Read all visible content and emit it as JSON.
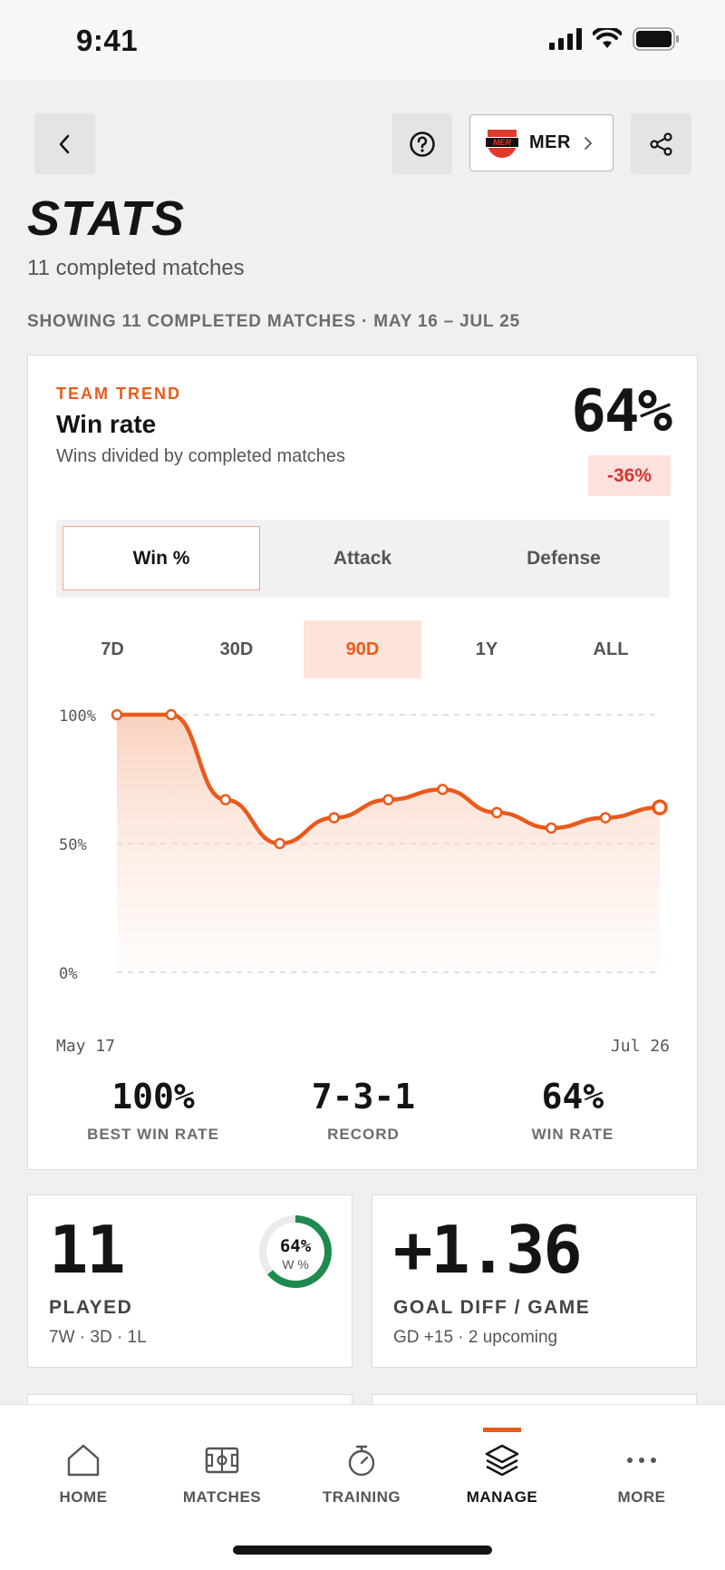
{
  "status_bar": {
    "time": "9:41"
  },
  "header": {
    "team_abbr": "MER",
    "team_logo_text": "MER",
    "title": "STATS",
    "subtitle": "11 completed matches",
    "range_caption": "SHOWING 11 COMPLETED MATCHES · MAY 16 – JUL 25"
  },
  "trend_card": {
    "eyebrow": "TEAM TREND",
    "metric_title": "Win rate",
    "metric_desc": "Wins divided by completed matches",
    "value": "64%",
    "delta": "-36%",
    "segments": [
      "Win %",
      "Attack",
      "Defense"
    ],
    "active_segment": "Win %",
    "periods": [
      "7D",
      "30D",
      "90D",
      "1Y",
      "ALL"
    ],
    "active_period": "90D",
    "date_start": "May 17",
    "date_end": "Jul 26",
    "summary": [
      {
        "value": "100%",
        "label": "BEST WIN RATE"
      },
      {
        "value": "7-3-1",
        "label": "RECORD"
      },
      {
        "value": "64%",
        "label": "WIN RATE"
      }
    ]
  },
  "chart_data": {
    "type": "line",
    "title": "Win rate",
    "ylim": [
      0,
      100
    ],
    "y_ticks": [
      "100%",
      "50%",
      "0%"
    ],
    "x": [
      "May 17",
      "",
      "",
      "",
      "",
      "",
      "",
      "",
      "",
      "",
      "Jul 26"
    ],
    "series": [
      {
        "values": [
          100,
          100,
          67,
          50,
          60,
          67,
          71,
          62,
          56,
          60,
          64
        ]
      }
    ],
    "grid": true,
    "accent": "#ea5a1b"
  },
  "cards": {
    "played": {
      "value": "11",
      "label": "PLAYED",
      "sub": "7W · 3D · 1L",
      "ring_pct": "64%",
      "ring_label": "W %",
      "ring_fraction": 0.64
    },
    "goal_diff": {
      "value": "+1.36",
      "label": "GOAL DIFF / GAME",
      "sub": "GD +15 · 2 upcoming"
    }
  },
  "tabs": [
    {
      "label": "HOME",
      "icon": "house-icon"
    },
    {
      "label": "MATCHES",
      "icon": "pitch-icon"
    },
    {
      "label": "TRAINING",
      "icon": "stopwatch-icon"
    },
    {
      "label": "MANAGE",
      "icon": "layers-icon"
    },
    {
      "label": "MORE",
      "icon": "more-dots-icon"
    }
  ],
  "active_tab": "MANAGE",
  "colors": {
    "accent": "#ea5a1b",
    "negative": "#d9342b",
    "positive_ring": "#1e8a4c"
  }
}
